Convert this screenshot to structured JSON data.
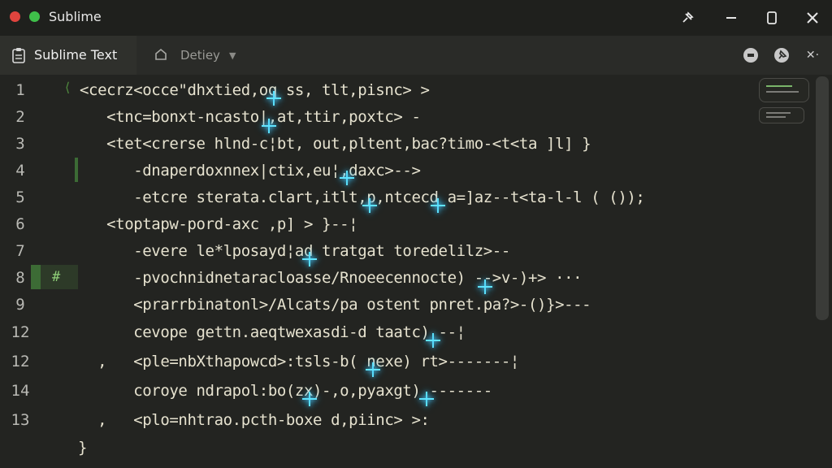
{
  "window": {
    "title": "Sublime",
    "colors": {
      "close": "#e0443e",
      "maximize": "#3fbf4a",
      "accent_green": "#3c6b35",
      "cursor": "#5fe4ff"
    },
    "controls": [
      "pin-icon",
      "minimize-icon",
      "restore-icon",
      "close-icon"
    ]
  },
  "tabs": {
    "active": {
      "label": "Sublime Text",
      "icon": "clipboard-icon"
    },
    "inactive": {
      "label": "Detiey",
      "icon": "home-icon",
      "caret": "▼"
    },
    "toolbar_icons": [
      "record-icon",
      "pin-icon",
      "more-icon"
    ],
    "toolbar_more_label": "✕·"
  },
  "gutter": {
    "line_numbers": [
      "1",
      "2",
      "3",
      "4",
      "5",
      "6",
      "7",
      "8",
      "9",
      "12",
      "12",
      "14",
      "13"
    ],
    "marker_line": "#",
    "fold_glyph": "⟨"
  },
  "code": {
    "lines": [
      "<cecrz<occe\"dhxtied,oq ss, tlt,pisnc> >",
      "   <tnc=bonxt-ncasto|,at,ttir,poxtc> -",
      "   <tet<crerse hlnd-c¦bt, out,pltent,bac?timo-<t<ta ]l] }",
      "      -dnaperdoxnnex|ctix,eu¦,daxc>-->",
      "      -etcre sterata.clart,itlt,p,ntcecd a=]az--t<ta-l-l ( ());",
      "   <toptapw-pord-axc ,p] > }--¦",
      "      -evere le*lposayd¦ad tratgat toredelilz>--",
      "      -pvochnidnetaracloasse/Rnoeecennocte) -->v-)+> ···",
      "      <prarrbinatonl>/Alcats/pa ostent pnret.pa?>-()}>---",
      "      cevope gettn.aeqtwexasdi-d taatc) --¦",
      "  ,   <ple=nbXthapowcd>:tsls-b( nexe) rt>-------¦",
      "      coroye ndrapol:bo(zx)-,o,pyaxgt) -------",
      "  ,   <plo=nhtrao.pcth-boxe d,piinc> >:",
      "}"
    ]
  }
}
